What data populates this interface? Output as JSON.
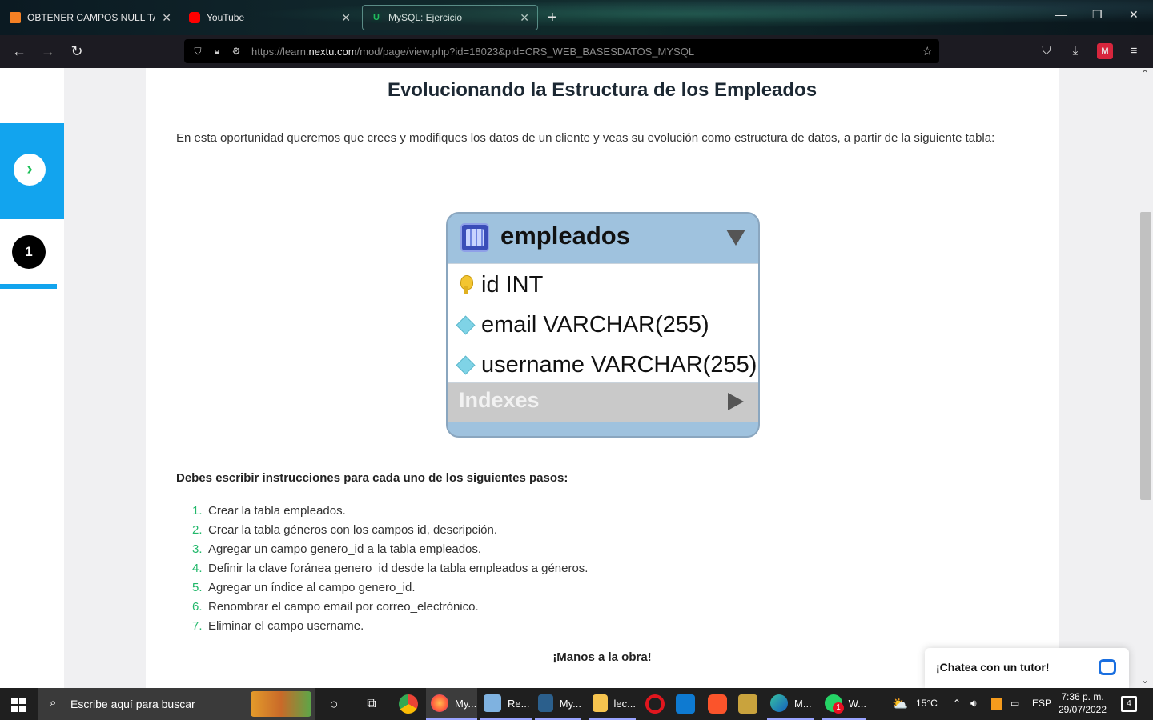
{
  "browser": {
    "tabs": [
      {
        "title": "OBTENER CAMPOS NULL TABLA",
        "icon": "stackoverflow-icon",
        "color": "#f48024"
      },
      {
        "title": "YouTube",
        "icon": "youtube-icon",
        "color": "#ff0000"
      },
      {
        "title": "MySQL: Ejercicio",
        "icon": "nextu-icon",
        "color": "#1ec15a"
      }
    ],
    "url_prefix": "https://learn.",
    "url_domain": "nextu.com",
    "url_suffix": "/mod/page/view.php?id=18023&pid=CRS_WEB_BASESDATOS_MYSQL"
  },
  "sidebar": {
    "next_icon": "chevron-right-icon",
    "step_number": "1"
  },
  "article": {
    "title": "Evolucionando la Estructura de los Empleados",
    "intro": "En esta oportunidad queremos que crees y modifiques los datos de un cliente y veas su evolución como estructura de datos, a partir de la siguiente tabla:",
    "diagram": {
      "table_name": "empleados",
      "fields": [
        {
          "icon": "key-icon",
          "text": "id INT"
        },
        {
          "icon": "diamond-icon",
          "text": "email VARCHAR(255)"
        },
        {
          "icon": "diamond-icon",
          "text": "username VARCHAR(255)"
        }
      ],
      "indexes_label": "Indexes"
    },
    "steps_title": "Debes escribir instrucciones para cada uno de los siguientes pasos:",
    "steps": [
      {
        "n": "1.",
        "text": "Crear la tabla empleados."
      },
      {
        "n": "2.",
        "text": "Crear la tabla géneros con los campos id, descripción."
      },
      {
        "n": "3.",
        "text": "Agregar un campo genero_id a la tabla empleados."
      },
      {
        "n": "4.",
        "text": "Definir la clave foránea genero_id desde la tabla empleados a géneros."
      },
      {
        "n": "5.",
        "text": "Agregar un índice al campo genero_id."
      },
      {
        "n": "6.",
        "text": "Renombrar el campo email por correo_electrónico."
      },
      {
        "n": "7.",
        "text": "Eliminar el campo username."
      }
    ],
    "closing": "¡Manos a la obra!"
  },
  "chat": {
    "label": "¡Chatea con un tutor!"
  },
  "taskbar": {
    "search_placeholder": "Escribe aquí para buscar",
    "apps": [
      {
        "label": "My...",
        "icon": "firefox-icon"
      },
      {
        "label": "Re...",
        "icon": "paint-icon"
      },
      {
        "label": "My...",
        "icon": "mysql-workbench-icon"
      },
      {
        "label": "lec...",
        "icon": "folder-icon"
      },
      {
        "label": "M...",
        "icon": "edge-icon"
      },
      {
        "label": "W...",
        "icon": "whatsapp-icon"
      }
    ],
    "whatsapp_badge": "1",
    "temperature": "15°C",
    "language": "ESP",
    "time": "7:36 p. m.",
    "date": "29/07/2022",
    "notifications": "4"
  }
}
